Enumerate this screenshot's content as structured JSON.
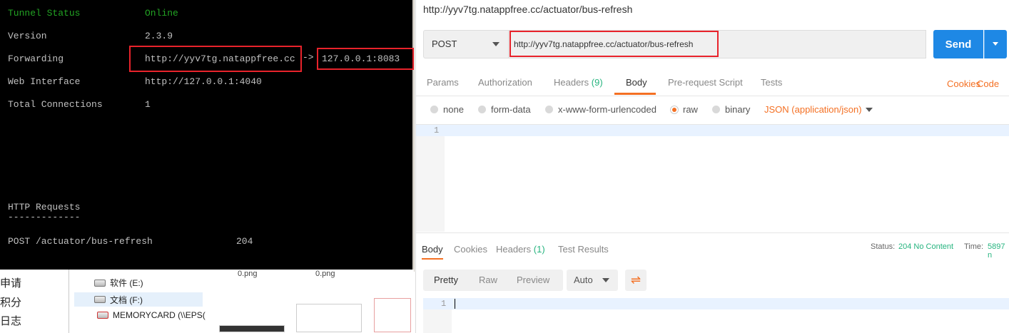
{
  "terminal": {
    "rows": [
      {
        "label": "Tunnel Status",
        "value": "Online"
      },
      {
        "label": "Version",
        "value": "2.3.9"
      },
      {
        "label": "Forwarding",
        "value": "http://yyv7tg.natappfree.cc"
      },
      {
        "label": "Web Interface",
        "value": "http://127.0.0.1:4040"
      },
      {
        "label": "Total Connections",
        "value": "1"
      }
    ],
    "forward_target": "127.0.0.1:8083",
    "arrow": "->",
    "http_requests_title": "HTTP Requests",
    "http_requests_rule": "-------------",
    "request": {
      "path": "POST /actuator/bus-refresh",
      "code": "204"
    }
  },
  "explorer": {
    "side_items": [
      "申请",
      "积分",
      "日志"
    ],
    "tree_items": [
      "软件 (E:)",
      "文档 (F:)",
      "MEMORYCARD (\\\\EPS("
    ],
    "thumb_labels": [
      "0.png",
      "0.png"
    ]
  },
  "postman": {
    "title": "http://yyv7tg.natappfree.cc/actuator/bus-refresh",
    "method": "POST",
    "url": "http://yyv7tg.natappfree.cc/actuator/bus-refresh",
    "send_label": "Send",
    "tabs": [
      "Params",
      "Authorization",
      "Headers",
      "Body",
      "Pre-request Script",
      "Tests"
    ],
    "headers_count": "(9)",
    "tabs_right": [
      "Cookies",
      "Code"
    ],
    "body_options": [
      "none",
      "form-data",
      "x-www-form-urlencoded",
      "raw",
      "binary"
    ],
    "content_type": "JSON (application/json)",
    "editor_line": "1",
    "response_tabs": [
      "Body",
      "Cookies",
      "Headers",
      "Test Results"
    ],
    "response_headers_count": "(1)",
    "status_label": "Status:",
    "status_value": "204 No Content",
    "time_label": "Time:",
    "time_value": "5897 n",
    "view_modes": [
      "Pretty",
      "Raw",
      "Preview"
    ],
    "format": "Auto",
    "response_line": "1"
  },
  "colors": {
    "accent": "#f47023",
    "send_blue": "#1e88e5",
    "highlight_red": "#e8232b",
    "terminal_green": "#22a323",
    "status_green": "#26b47f"
  }
}
